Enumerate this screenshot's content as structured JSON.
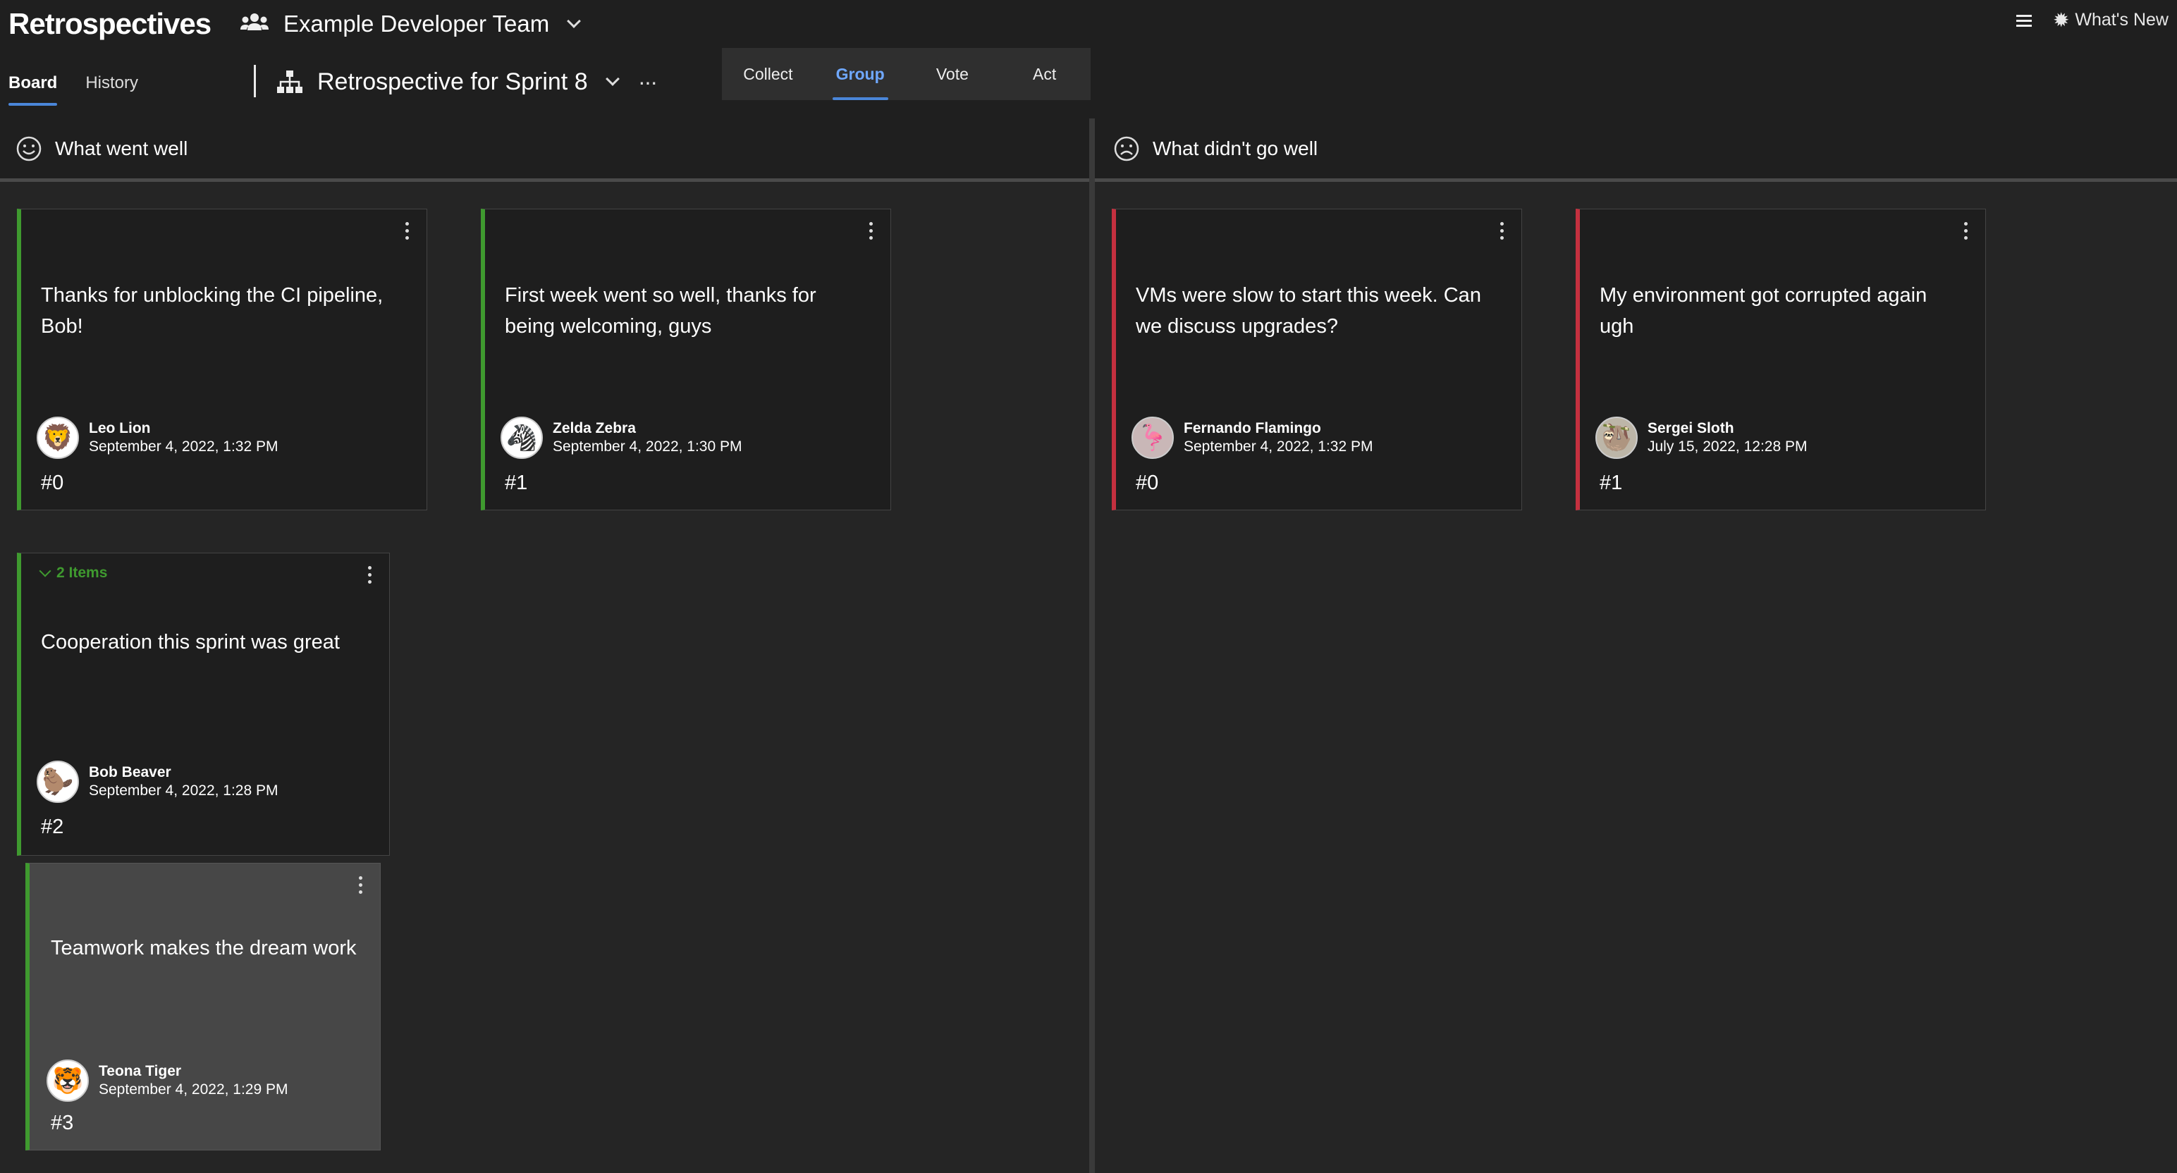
{
  "app": {
    "title": "Retrospectives"
  },
  "team": {
    "name": "Example Developer Team"
  },
  "nav": {
    "tabs": [
      {
        "label": "Board"
      },
      {
        "label": "History"
      }
    ]
  },
  "board": {
    "name": "Retrospective for Sprint 8",
    "more": "···"
  },
  "phases": [
    {
      "label": "Collect"
    },
    {
      "label": "Group"
    },
    {
      "label": "Vote"
    },
    {
      "label": "Act"
    }
  ],
  "header_right": {
    "whats_new": "What's New"
  },
  "columns": [
    {
      "title": "What went well",
      "accent": "#3f9a2f",
      "cards": [
        {
          "text": "Thanks for unblocking the CI pipeline, Bob!",
          "author": "Leo Lion",
          "date": "September 4, 2022, 1:32 PM",
          "num": "#0",
          "avatar_icon": "lion-avatar-icon"
        },
        {
          "text": "First week went so well, thanks for being welcoming, guys",
          "author": "Zelda Zebra",
          "date": "September 4, 2022, 1:30 PM",
          "num": "#1",
          "avatar_icon": "zebra-avatar-icon"
        }
      ],
      "group": {
        "toggle_label": "2 Items",
        "parent": {
          "text": "Cooperation this sprint was great",
          "author": "Bob Beaver",
          "date": "September 4, 2022, 1:28 PM",
          "num": "#2",
          "avatar_icon": "beaver-avatar-icon"
        },
        "child": {
          "text": "Teamwork makes the dream work",
          "author": "Teona Tiger",
          "date": "September 4, 2022, 1:29 PM",
          "num": "#3",
          "avatar_icon": "tiger-avatar-icon"
        }
      }
    },
    {
      "title": "What didn't go well",
      "accent": "#c4303f",
      "cards": [
        {
          "text": "VMs were slow to start this week. Can we discuss upgrades?",
          "author": "Fernando Flamingo",
          "date": "September 4, 2022, 1:32 PM",
          "num": "#0",
          "avatar_icon": "flamingo-avatar-icon"
        },
        {
          "text": "My environment got corrupted again ugh",
          "author": "Sergei Sloth",
          "date": "July 15, 2022, 12:28 PM",
          "num": "#1",
          "avatar_icon": "sloth-avatar-icon"
        }
      ]
    }
  ]
}
